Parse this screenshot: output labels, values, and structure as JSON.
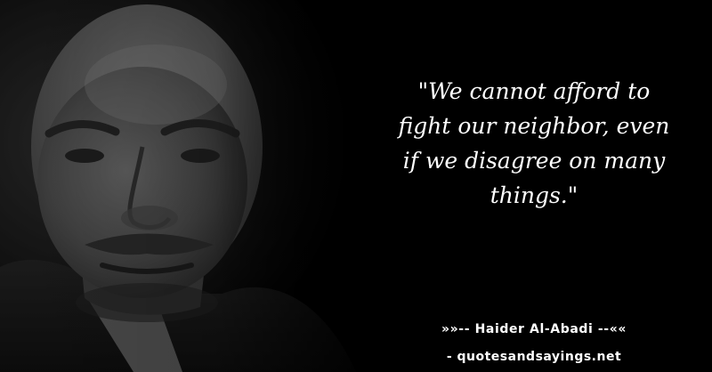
{
  "quote": {
    "lines": [
      "\"We cannot afford to",
      "fight our neighbor, even",
      "if we disagree on many",
      "things.\""
    ]
  },
  "attribution": {
    "text": "»»-- Haider Al-Abadi --««"
  },
  "site": {
    "text": "- quotesandsayings.net"
  },
  "colors": {
    "background": "#000000",
    "text": "#ffffff"
  }
}
